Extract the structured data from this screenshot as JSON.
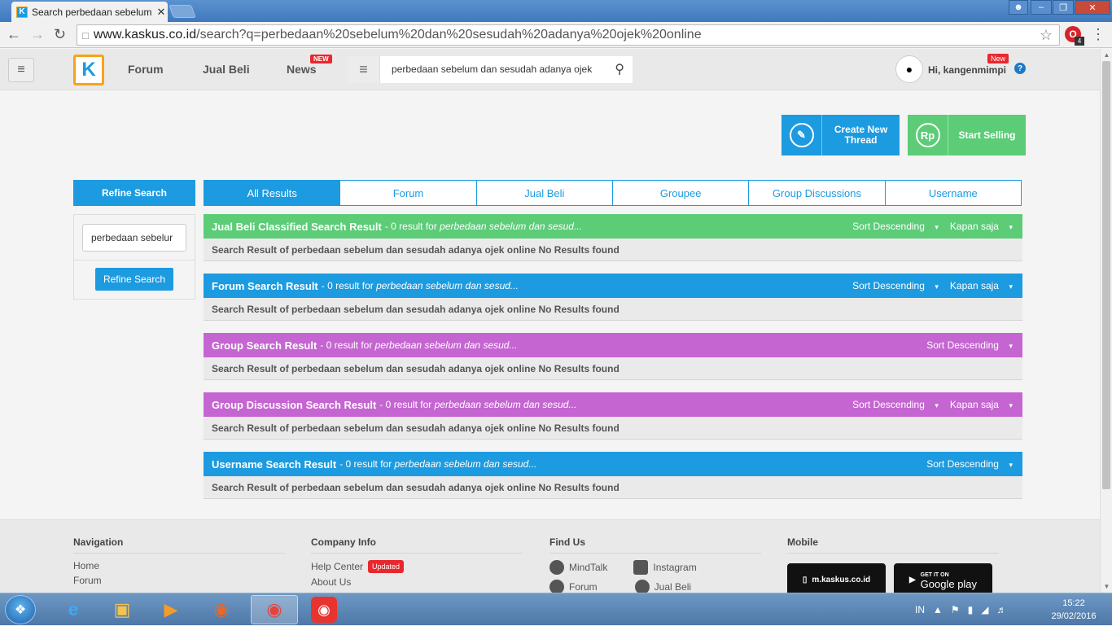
{
  "browser": {
    "tab_title": "Search perbedaan sebelum",
    "tab_close": "✕",
    "url_domain": "www.kaskus.co.id",
    "url_path": "/search?q=perbedaan%20sebelum%20dan%20sesudah%20adanya%20ojek%20online",
    "ext_badge": "4"
  },
  "header": {
    "logo_text": "K",
    "nav": [
      "Forum",
      "Jual Beli",
      "News"
    ],
    "news_badge": "NEW",
    "search_value": "perbedaan sebelum dan sesudah adanya ojek",
    "greeting": "Hi, kangenmimpi",
    "new_badge": "New",
    "help": "?"
  },
  "actions": {
    "create_thread_line1": "Create New",
    "create_thread_line2": "Thread",
    "start_selling": "Start Selling",
    "selling_icon_text": "Rp"
  },
  "refine": {
    "title": "Refine Search",
    "input_value": "perbedaan sebelur",
    "button": "Refine Search"
  },
  "tabs": [
    "All Results",
    "Forum",
    "Jual Beli",
    "Groupee",
    "Group Discussions",
    "Username"
  ],
  "sections": [
    {
      "title": "Jual Beli Classified Search Result",
      "sub": " - 0 result for ",
      "term": "perbedaan sebelum dan sesud...",
      "sort": "Sort Descending",
      "time": "Kapan saja",
      "body": "Search Result of perbedaan sebelum dan sesudah adanya ojek online No Results found",
      "color": "#5ccc77"
    },
    {
      "title": "Forum Search Result",
      "sub": " - 0 result for ",
      "term": "perbedaan sebelum dan sesud...",
      "sort": "Sort Descending",
      "time": "Kapan saja",
      "body": "Search Result of perbedaan sebelum dan sesudah adanya ojek online No Results found",
      "color": "#1c9be0"
    },
    {
      "title": "Group Search Result",
      "sub": " - 0 result for ",
      "term": "perbedaan sebelum dan sesud...",
      "sort": "Sort Descending",
      "time": "",
      "body": "Search Result of perbedaan sebelum dan sesudah adanya ojek online No Results found",
      "color": "#c565d1"
    },
    {
      "title": "Group Discussion Search Result",
      "sub": " - 0 result for ",
      "term": "perbedaan sebelum dan sesud...",
      "sort": "Sort Descending",
      "time": "Kapan saja",
      "body": "Search Result of perbedaan sebelum dan sesudah adanya ojek online No Results found",
      "color": "#c565d1"
    },
    {
      "title": "Username Search Result",
      "sub": " - 0 result for ",
      "term": "perbedaan sebelum dan sesud...",
      "sort": "Sort Descending",
      "time": "",
      "body": "Search Result of perbedaan sebelum dan sesudah adanya ojek online No Results found",
      "color": "#1c9be0"
    }
  ],
  "footer": {
    "navigation": {
      "title": "Navigation",
      "links": [
        "Home",
        "Forum"
      ]
    },
    "company": {
      "title": "Company Info",
      "links": [
        "Help Center",
        "About Us"
      ],
      "updated_badge": "Updated"
    },
    "findus": {
      "title": "Find Us",
      "links": [
        "MindTalk",
        "Instagram",
        "Forum",
        "Jual Beli"
      ]
    },
    "mobile": {
      "title": "Mobile",
      "mkaskus": "m.kaskus.co.id",
      "gplay_small": "GET IT ON",
      "gplay": "Google play"
    }
  },
  "taskbar": {
    "lang": "IN",
    "time": "15:22",
    "date": "29/02/2016"
  }
}
